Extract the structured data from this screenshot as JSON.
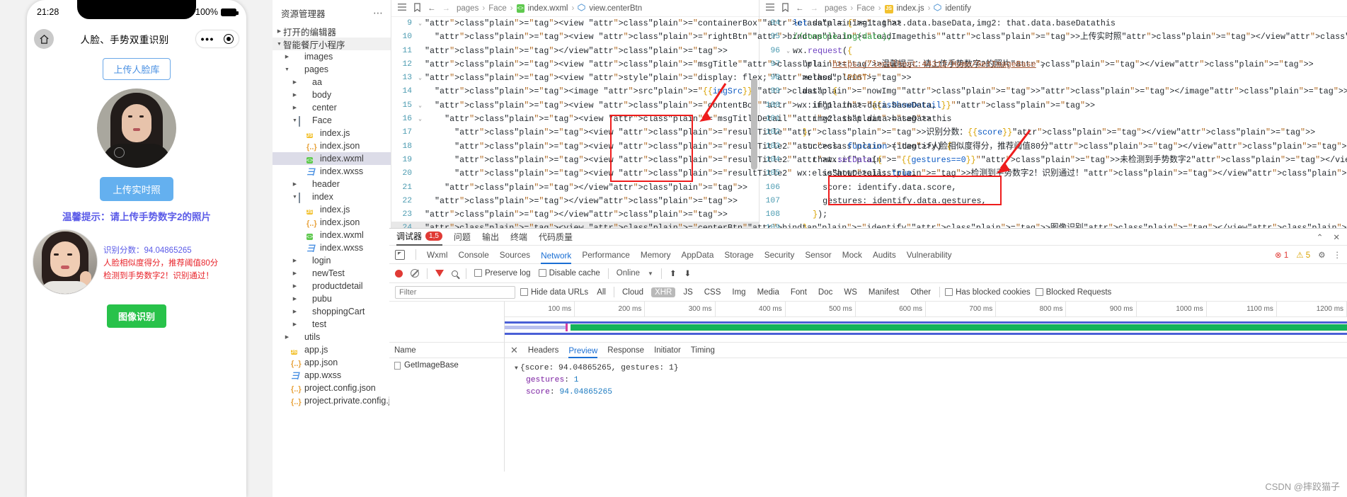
{
  "simulator": {
    "status_time": "21:28",
    "battery_percent": "100%",
    "nav_title": "人脸、手势双重识别",
    "home_icon": "home-icon",
    "capsule_more": "•••",
    "upload_face_lib_btn": "上传人脸库",
    "upload_live_photo_btn": "上传实时照",
    "tip_text": "温馨提示：请上传手势数字2的照片",
    "result_score_label": "识别分数：94.04865265",
    "result_line2": "人脸相似度得分，推荐阈值80分",
    "result_line3": "检测到手势数字2！识别通过！",
    "identify_btn": "图像识别"
  },
  "explorer": {
    "title": "资源管理器",
    "more_icon": "ellipsis-icon",
    "open_editors": "打开的编辑器",
    "project_root": "智能餐厅小程序",
    "tree": [
      {
        "label": "images",
        "depth": 1,
        "type": "folder-teal",
        "arrow": "▸"
      },
      {
        "label": "pages",
        "depth": 1,
        "type": "folder-red",
        "arrow": "▾"
      },
      {
        "label": "aa",
        "depth": 2,
        "type": "folder",
        "arrow": "▸"
      },
      {
        "label": "body",
        "depth": 2,
        "type": "folder",
        "arrow": "▸"
      },
      {
        "label": "center",
        "depth": 2,
        "type": "folder",
        "arrow": "▸"
      },
      {
        "label": "Face",
        "depth": 2,
        "type": "folder-open",
        "arrow": "▾"
      },
      {
        "label": "index.js",
        "depth": 3,
        "type": "js",
        "arrow": ""
      },
      {
        "label": "index.json",
        "depth": 3,
        "type": "json",
        "arrow": ""
      },
      {
        "label": "index.wxml",
        "depth": 3,
        "type": "wxml",
        "arrow": "",
        "selected": true
      },
      {
        "label": "index.wxss",
        "depth": 3,
        "type": "wxss",
        "arrow": ""
      },
      {
        "label": "header",
        "depth": 2,
        "type": "folder",
        "arrow": "▸"
      },
      {
        "label": "index",
        "depth": 2,
        "type": "folder-open",
        "arrow": "▾"
      },
      {
        "label": "index.js",
        "depth": 3,
        "type": "js",
        "arrow": ""
      },
      {
        "label": "index.json",
        "depth": 3,
        "type": "json",
        "arrow": ""
      },
      {
        "label": "index.wxml",
        "depth": 3,
        "type": "wxml",
        "arrow": ""
      },
      {
        "label": "index.wxss",
        "depth": 3,
        "type": "wxss",
        "arrow": ""
      },
      {
        "label": "login",
        "depth": 2,
        "type": "folder",
        "arrow": "▸"
      },
      {
        "label": "newTest",
        "depth": 2,
        "type": "folder",
        "arrow": "▸"
      },
      {
        "label": "productdetail",
        "depth": 2,
        "type": "folder",
        "arrow": "▸"
      },
      {
        "label": "pubu",
        "depth": 2,
        "type": "folder",
        "arrow": "▸"
      },
      {
        "label": "shoppingCart",
        "depth": 2,
        "type": "folder",
        "arrow": "▸"
      },
      {
        "label": "test",
        "depth": 2,
        "type": "folder-teal",
        "arrow": "▸"
      },
      {
        "label": "utils",
        "depth": 1,
        "type": "folder-teal2",
        "arrow": "▸"
      },
      {
        "label": "app.js",
        "depth": 1,
        "type": "js",
        "arrow": ""
      },
      {
        "label": "app.json",
        "depth": 1,
        "type": "json",
        "arrow": ""
      },
      {
        "label": "app.wxss",
        "depth": 1,
        "type": "wxss",
        "arrow": ""
      },
      {
        "label": "project.config.json",
        "depth": 1,
        "type": "json",
        "arrow": ""
      },
      {
        "label": "project.private.config.js...",
        "depth": 1,
        "type": "json",
        "arrow": ""
      }
    ]
  },
  "editor_left": {
    "breadcrumb": [
      "pages",
      "Face",
      "index.wxml",
      "view.centerBtn"
    ],
    "file_icon": "wxml-file-icon",
    "symbol_icon": "symbol-icon",
    "lines": [
      {
        "n": "9",
        "fold": "▾",
        "text": "<view class=\"containerBox\">",
        "indent": 0
      },
      {
        "n": "10",
        "fold": "",
        "text": "<view class=\"rightBtn\" bindtap=\"loadImagethis\">上传实时照</view>",
        "indent": 1
      },
      {
        "n": "11",
        "fold": "",
        "text": "</view>",
        "indent": 0
      },
      {
        "n": "12",
        "fold": "",
        "text": "<view class=\"msgTitle\">温馨提示：请上传手势数字2的照片</view>",
        "indent": 0
      },
      {
        "n": "13",
        "fold": "▾",
        "text": "<view style=\"display: flex;\" >",
        "indent": 0
      },
      {
        "n": "14",
        "fold": "",
        "text": "<image src=\"{{imgSrc}}\" class=\"nowImg\"></image>",
        "indent": 1
      },
      {
        "n": "15",
        "fold": "▾",
        "text": "<view class=\"contentBox\" wx:if=\"{{isShowDetail}}\">",
        "indent": 1
      },
      {
        "n": "16",
        "fold": "▾",
        "text": "<view class=\"msgTitleDetail\">",
        "indent": 2
      },
      {
        "n": "17",
        "fold": "",
        "text": "<view class=\"resultTitle\">识别分数：{{score}}</view>",
        "indent": 3
      },
      {
        "n": "18",
        "fold": "",
        "text": "<view class=\"resultTitle2\">人脸相似度得分，推荐阈值80分</view>",
        "indent": 3
      },
      {
        "n": "19",
        "fold": "",
        "text": "<view class=\"resultTitle2\" wx:if=\"{{gestures==0}}\">未检测到手势数字2</view>",
        "indent": 3
      },
      {
        "n": "20",
        "fold": "",
        "text": "<view class=\"resultTitle2\" wx:else>检测到手势数字2！识别通过！</view>",
        "indent": 3
      },
      {
        "n": "21",
        "fold": "",
        "text": "</view>",
        "indent": 2
      },
      {
        "n": "22",
        "fold": "",
        "text": "</view>",
        "indent": 1
      },
      {
        "n": "23",
        "fold": "",
        "text": "</view>",
        "indent": 0
      },
      {
        "n": "24",
        "fold": "",
        "text": "<view class=\"centerBtn\" bindtap=\"identify\">图像识别</view>",
        "indent": 0,
        "current": true
      }
    ]
  },
  "editor_right": {
    "breadcrumb": [
      "pages",
      "Face",
      "index.js",
      "identify"
    ],
    "file_icon": "js-file-icon",
    "symbol_icon": "symbol-icon",
    "lines": [
      {
        "n": "94",
        "fold": "",
        "text": "let data = {img1: that.data.baseData,img2: that.data.baseDatathis",
        "indent": 0
      },
      {
        "n": "95",
        "fold": "",
        "text": "//console.log(data);",
        "indent": 0,
        "comment": true
      },
      {
        "n": "96",
        "fold": "▾",
        "text": "wx.request({",
        "indent": 0
      },
      {
        "n": "97",
        "fold": "",
        "text": "url: 'https://localhost:44312/Home/GetImageBase',",
        "indent": 1
      },
      {
        "n": "98",
        "fold": "",
        "text": "method: 'POST',",
        "indent": 1
      },
      {
        "n": "99",
        "fold": "▾",
        "text": "data: {",
        "indent": 1
      },
      {
        "n": "100",
        "fold": "",
        "text": "img1: that.data.baseData,",
        "indent": 2
      },
      {
        "n": "101",
        "fold": "",
        "text": "img2: that.data.baseDatathis",
        "indent": 2
      },
      {
        "n": "102",
        "fold": "",
        "text": "},",
        "indent": 1
      },
      {
        "n": "103",
        "fold": "▾",
        "text": "success: function (identify) {",
        "indent": 1
      },
      {
        "n": "104",
        "fold": "▾",
        "text": "that.setData({",
        "indent": 2
      },
      {
        "n": "105",
        "fold": "",
        "text": "isShowDetail: true,",
        "indent": 3
      },
      {
        "n": "106",
        "fold": "",
        "text": "score: identify.data.score,",
        "indent": 3
      },
      {
        "n": "107",
        "fold": "",
        "text": "gestures: identify.data.gestures,",
        "indent": 3
      },
      {
        "n": "108",
        "fold": "",
        "text": "});",
        "indent": 2
      },
      {
        "n": "109",
        "fold": "",
        "text": "}",
        "indent": 1
      }
    ]
  },
  "devtools": {
    "panel_tabs": [
      {
        "label": "调试器",
        "active": true,
        "badge": "1,5"
      },
      {
        "label": "问题",
        "active": false
      },
      {
        "label": "输出",
        "active": false
      },
      {
        "label": "终端",
        "active": false
      },
      {
        "label": "代码质量",
        "active": false
      }
    ],
    "window_controls": [
      "⌃",
      "✕"
    ],
    "tabs": [
      {
        "label": "Wxml",
        "active": false
      },
      {
        "label": "Console",
        "active": false
      },
      {
        "label": "Sources",
        "active": false
      },
      {
        "label": "Network",
        "active": true
      },
      {
        "label": "Performance",
        "active": false
      },
      {
        "label": "Memory",
        "active": false
      },
      {
        "label": "AppData",
        "active": false
      },
      {
        "label": "Storage",
        "active": false
      },
      {
        "label": "Security",
        "active": false
      },
      {
        "label": "Sensor",
        "active": false
      },
      {
        "label": "Mock",
        "active": false
      },
      {
        "label": "Audits",
        "active": false
      },
      {
        "label": "Vulnerability",
        "active": false
      }
    ],
    "inspect_icon": "inspect-icon",
    "error_count": "1",
    "warning_count": "5",
    "settings_icon": "gear-icon",
    "more_icon": "kebab-icon",
    "toolbar": {
      "record_icon": "record-icon",
      "clear_icon": "clear-icon",
      "filter_icon": "filter-icon",
      "search_icon": "search-icon",
      "preserve_log": "Preserve log",
      "disable_cache": "Disable cache",
      "throttle": "Online",
      "chevron_icon": "chevron-down-icon",
      "import_icon": "upload-icon",
      "export_icon": "download-icon"
    },
    "filter": {
      "placeholder": "Filter",
      "hide_data_urls": "Hide data URLs",
      "types": [
        "All",
        "Cloud",
        "XHR",
        "JS",
        "CSS",
        "Img",
        "Media",
        "Font",
        "Doc",
        "WS",
        "Manifest",
        "Other"
      ],
      "active_type": "XHR",
      "has_blocked_cookies": "Has blocked cookies",
      "blocked_requests": "Blocked Requests"
    },
    "timeline_ticks": [
      "100 ms",
      "200 ms",
      "300 ms",
      "400 ms",
      "500 ms",
      "600 ms",
      "700 ms",
      "800 ms",
      "900 ms",
      "1000 ms",
      "1100 ms",
      "1200 ms"
    ],
    "request_list": {
      "header": "Name",
      "rows": [
        {
          "name": "GetImageBase",
          "icon": "document-icon"
        }
      ]
    },
    "detail_tabs": [
      {
        "label": "Headers",
        "active": false
      },
      {
        "label": "Preview",
        "active": true
      },
      {
        "label": "Response",
        "active": false
      },
      {
        "label": "Initiator",
        "active": false
      },
      {
        "label": "Timing",
        "active": false
      }
    ],
    "close_icon": "close-icon",
    "preview": {
      "root": "{score: 94.04865265, gestures: 1}",
      "entries": [
        {
          "key": "gestures",
          "value": "1"
        },
        {
          "key": "score",
          "value": "94.04865265"
        }
      ]
    }
  },
  "watermark": "CSDN @摔跤猫子",
  "colors": {
    "accent_blue": "#4a90e2",
    "annotation_red": "#ee1c1c",
    "tip_purple": "#5b5be8",
    "error_red": "#e8232a",
    "success_green": "#28c24a"
  }
}
